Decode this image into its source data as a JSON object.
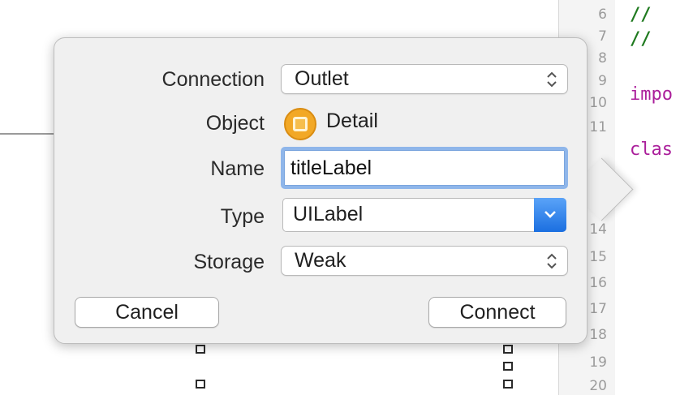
{
  "popover": {
    "connection": {
      "label": "Connection",
      "value": "Outlet",
      "icon": "updown-chevron-icon"
    },
    "object": {
      "label": "Object",
      "value": "Detail",
      "icon": "view-controller-icon",
      "icon_color": "#f2a826"
    },
    "name": {
      "label": "Name",
      "value": "titleLabel"
    },
    "type": {
      "label": "Type",
      "value": "UILabel",
      "icon": "chevron-down-icon",
      "accent": "#2a82f0"
    },
    "storage": {
      "label": "Storage",
      "value": "Weak",
      "icon": "updown-chevron-icon"
    },
    "buttons": {
      "cancel": "Cancel",
      "connect": "Connect"
    }
  },
  "editor": {
    "line_numbers": [
      "6",
      "7",
      "8",
      "9",
      "10",
      "11",
      "14",
      "15",
      "16",
      "17",
      "18",
      "19",
      "20"
    ],
    "code_lines": [
      {
        "line": "6",
        "text": "//"
      },
      {
        "line": "7",
        "text": "//"
      },
      {
        "line": "9",
        "text": "impo"
      },
      {
        "line": "11",
        "text": "clas"
      }
    ],
    "colors": {
      "comment": "#1f7a1f",
      "keyword": "#ab1f9b"
    }
  }
}
